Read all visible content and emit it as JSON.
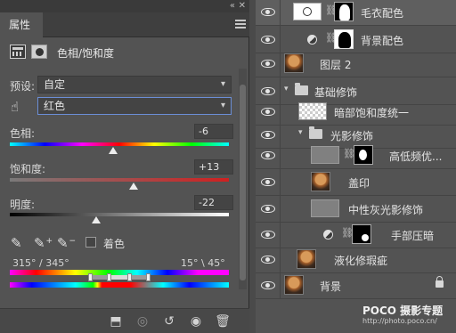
{
  "properties": {
    "tab_label": "属性",
    "header_title": "色相/饱和度",
    "preset_label": "预设:",
    "preset_value": "自定",
    "channel_value": "红色",
    "hue_label": "色相:",
    "hue_value": "-6",
    "saturation_label": "饱和度:",
    "saturation_value": "+13",
    "lightness_label": "明度:",
    "lightness_value": "-22",
    "colorize_label": "着色",
    "range_left": "315° / 345°",
    "range_right": "15° \\ 45°"
  },
  "layers": [
    {
      "name": "毛衣配色"
    },
    {
      "name": "背景配色"
    },
    {
      "name": "图层 2"
    },
    {
      "name": "基础修饰"
    },
    {
      "name": "暗部饱和度统一"
    },
    {
      "name": "光影修饰"
    },
    {
      "name": "高低频优..."
    },
    {
      "name": "盖印"
    },
    {
      "name": "中性灰光影修饰"
    },
    {
      "name": "手部压暗"
    },
    {
      "name": "液化修瑕疵"
    },
    {
      "name": "背景"
    }
  ],
  "watermark": {
    "brand": "POCO 摄影专题",
    "url": "http://photo.poco.cn/"
  },
  "colors": {
    "panel_bg": "#535353",
    "accent_blue": "#6b8ed6"
  }
}
